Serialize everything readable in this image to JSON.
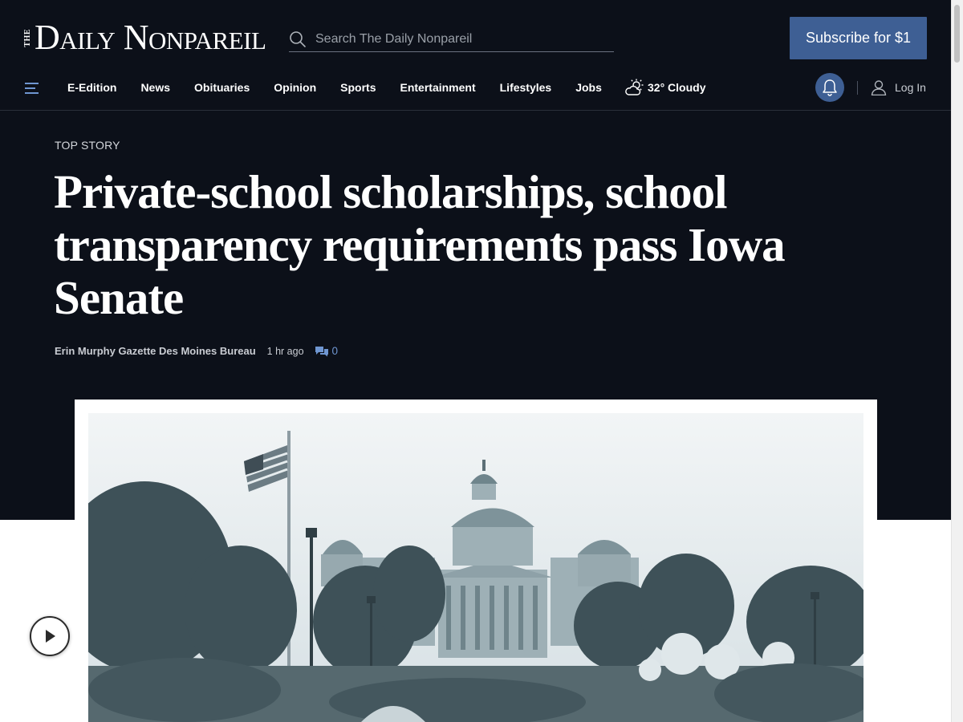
{
  "header": {
    "logo_the": "THE",
    "logo_name": "Daily Nonpareil",
    "search_placeholder": "Search The Daily Nonpareil",
    "subscribe_label": "Subscribe for $1"
  },
  "nav": {
    "items": [
      "E-Edition",
      "News",
      "Obituaries",
      "Opinion",
      "Sports",
      "Entertainment",
      "Lifestyles",
      "Jobs"
    ],
    "weather": "32° Cloudy",
    "login_label": "Log In"
  },
  "article": {
    "kicker": "TOP STORY",
    "headline": "Private-school scholarships, school transparency requirements pass Iowa Senate",
    "author": "Erin Murphy Gazette Des Moines Bureau",
    "time": "1 hr ago",
    "comment_count": "0"
  },
  "colors": {
    "header_bg": "#0c1019",
    "accent": "#3e5f94",
    "comment_link": "#6f96d1"
  },
  "icons": [
    "search-icon",
    "hamburger-menu-icon",
    "weather-cloud-sun-icon",
    "bell-icon",
    "user-icon",
    "comment-icon",
    "play-icon"
  ]
}
